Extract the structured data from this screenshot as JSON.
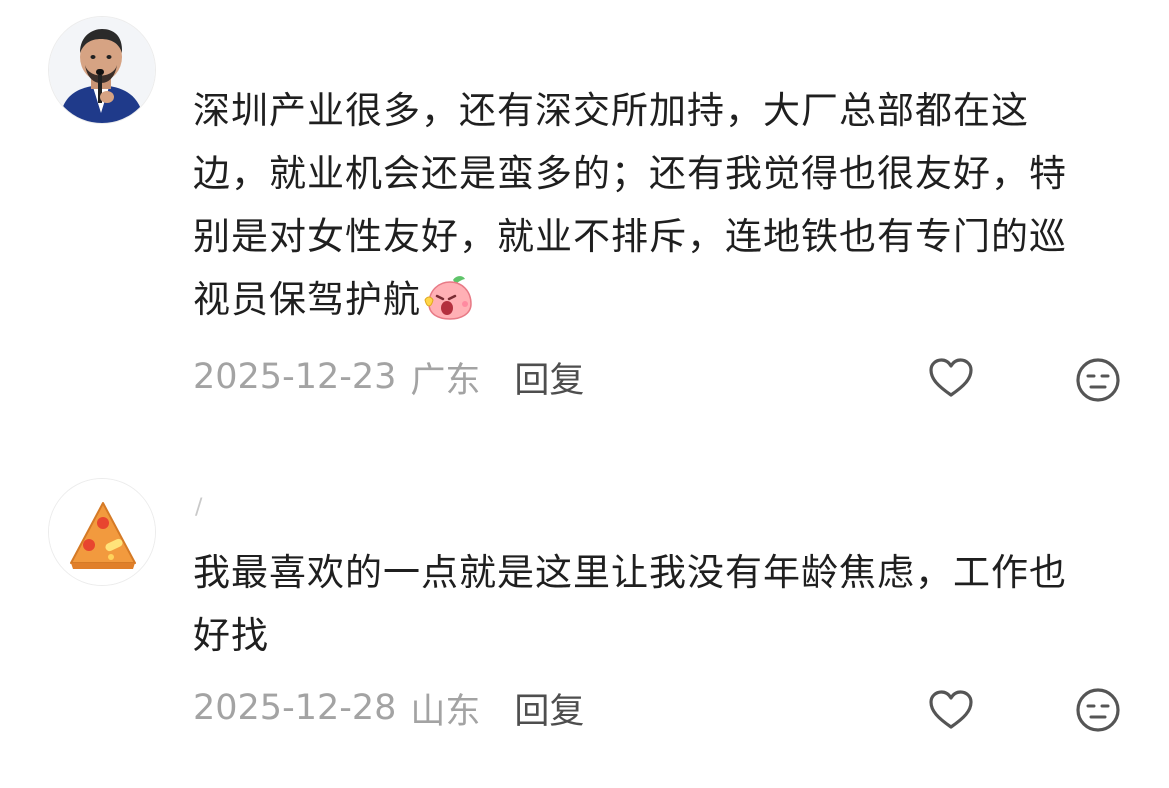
{
  "comments": [
    {
      "avatar": "man-with-microphone-avatar",
      "username": "",
      "content": "深圳产业很多，还有深交所加持，大厂总部都在这边，就业机会还是蛮多的；还有我觉得也很友好，特别是对女性友好，就业不排斥，连地铁也有专门的巡视员保驾护航",
      "emoji": "pink-peach-emoji",
      "date": "2025-12-23",
      "location": "广东",
      "reply_label": "回复",
      "like_icon": "heart-icon",
      "dislike_icon": "meh-face-icon"
    },
    {
      "avatar": "pizza-avatar",
      "username": "/",
      "content": "我最喜欢的一点就是这里让我没有年龄焦虑，工作也好找",
      "date": "2025-12-28",
      "location": "山东",
      "reply_label": "回复",
      "like_icon": "heart-icon",
      "dislike_icon": "meh-face-icon"
    }
  ],
  "colors": {
    "text": "#1f1f1f",
    "meta": "#a3a3a3",
    "reply": "#4e4e4e",
    "icon": "#555555",
    "pizza_orange": "#f29a3e",
    "pizza_red": "#e8452f"
  }
}
